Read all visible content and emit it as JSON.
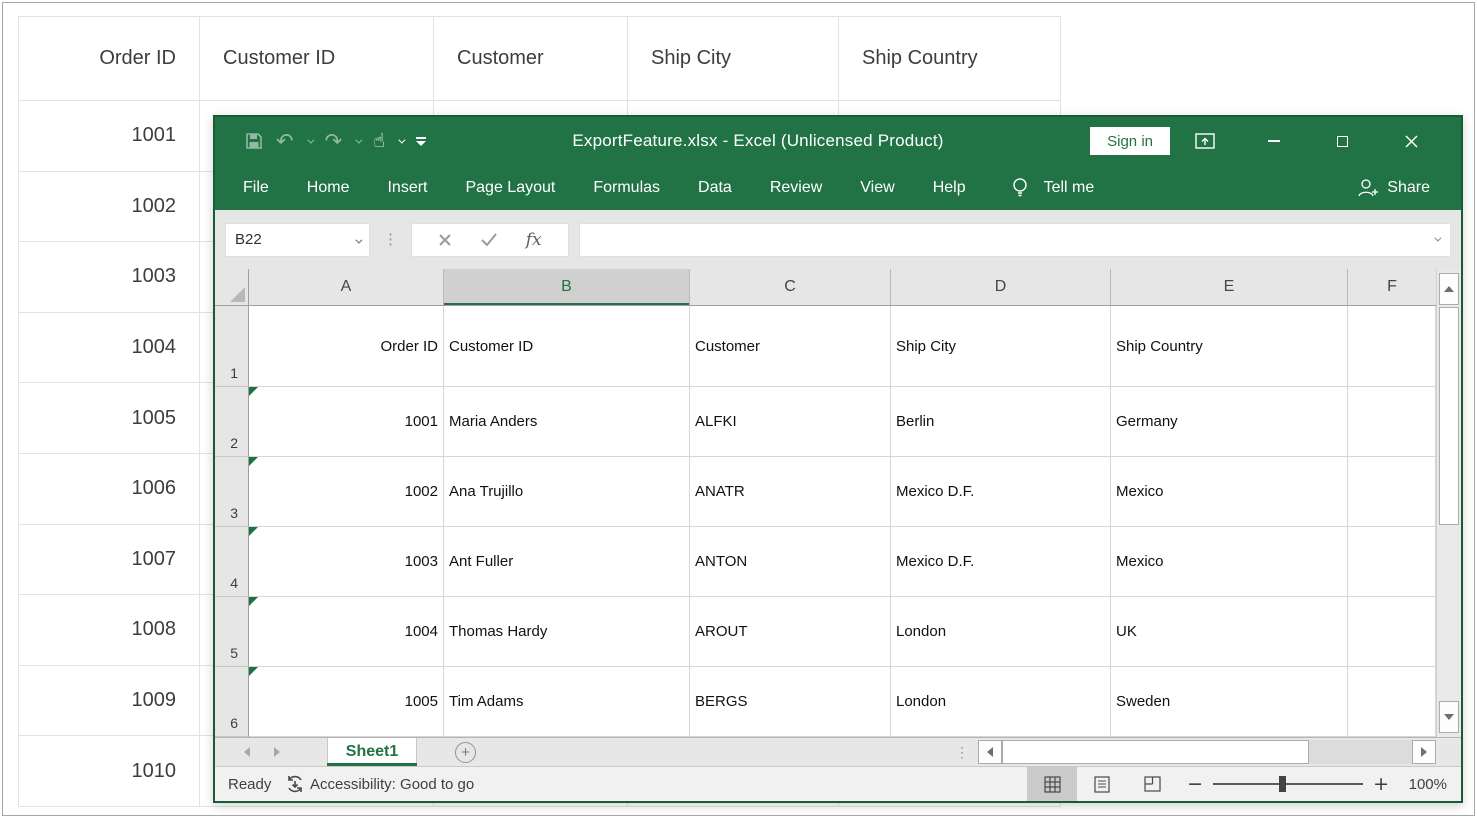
{
  "background_table": {
    "headers": [
      "Order ID",
      "Customer ID",
      "Customer",
      "Ship City",
      "Ship Country"
    ],
    "order_ids": [
      "1001",
      "1002",
      "1003",
      "1004",
      "1005",
      "1006",
      "1007",
      "1008",
      "1009",
      "1010"
    ]
  },
  "excel": {
    "title": "ExportFeature.xlsx - Excel (Unlicensed Product)",
    "sign_in_label": "Sign in",
    "menu_items": [
      "File",
      "Home",
      "Insert",
      "Page Layout",
      "Formulas",
      "Data",
      "Review",
      "View",
      "Help"
    ],
    "tell_me_label": "Tell me",
    "share_label": "Share",
    "formula_bar": {
      "name_box_value": "B22",
      "fx_label": "fx"
    },
    "grid": {
      "columns": [
        "A",
        "B",
        "C",
        "D",
        "E",
        "F"
      ],
      "selected_column": "B",
      "row_numbers": [
        "1",
        "2",
        "3",
        "4",
        "5",
        "6"
      ],
      "rows": [
        [
          "Order ID",
          "Customer ID",
          "Customer",
          "Ship City",
          "Ship Country"
        ],
        [
          "1001",
          "Maria Anders",
          "ALFKI",
          "Berlin",
          "Germany"
        ],
        [
          "1002",
          "Ana Trujillo",
          "ANATR",
          "Mexico D.F.",
          "Mexico"
        ],
        [
          "1003",
          "Ant Fuller",
          "ANTON",
          "Mexico D.F.",
          "Mexico"
        ],
        [
          "1004",
          "Thomas Hardy",
          "AROUT",
          "London",
          "UK"
        ],
        [
          "1005",
          "Tim Adams",
          "BERGS",
          "London",
          "Sweden"
        ]
      ]
    },
    "sheet_tab_label": "Sheet1",
    "new_sheet_label": "+",
    "vdots": "⋮",
    "status_bar": {
      "ready": "Ready",
      "accessibility": "Accessibility: Good to go",
      "zoom_level": "100%",
      "zoom_minus": "−",
      "zoom_plus": "+"
    },
    "colors": {
      "green": "#217346",
      "border_green": "#185c37"
    }
  }
}
